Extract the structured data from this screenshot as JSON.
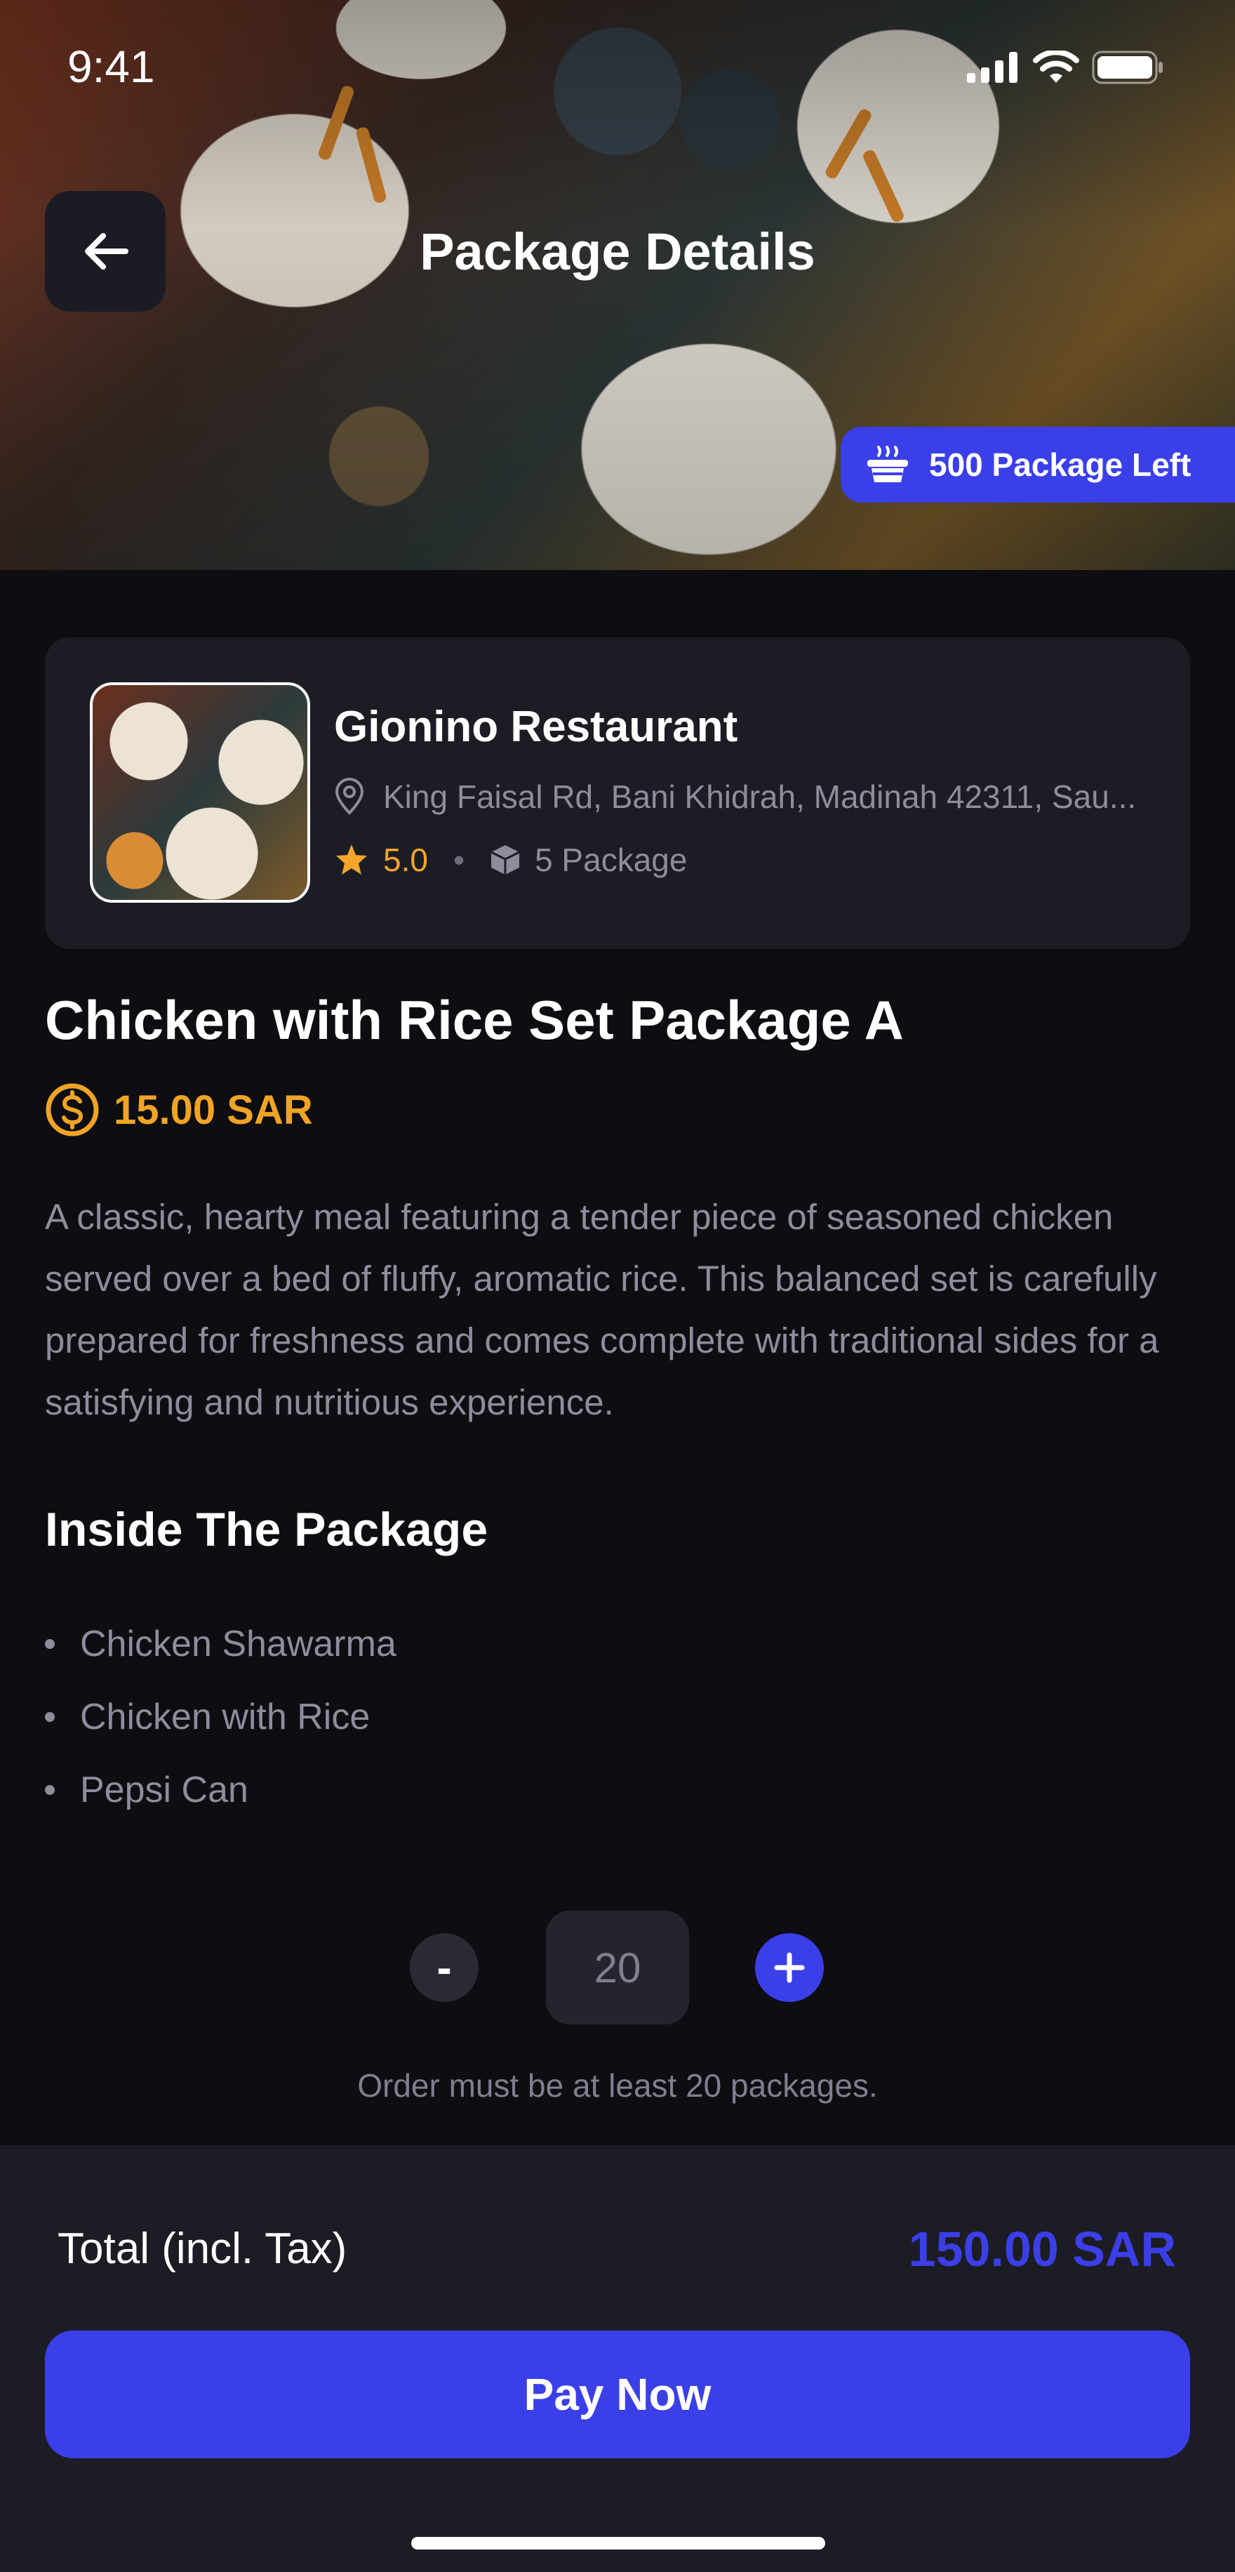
{
  "status_bar": {
    "time": "9:41"
  },
  "header": {
    "title": "Package Details",
    "packages_left": "500 Package Left"
  },
  "restaurant": {
    "name": "Gionino Restaurant",
    "address": "King Faisal Rd, Bani Khidrah, Madinah 42311, Sau...",
    "rating": "5.0",
    "package_count": "5 Package"
  },
  "package": {
    "title": "Chicken with Rice Set Package A",
    "price": "15.00 SAR",
    "description": "A classic, hearty meal featuring a tender piece of seasoned chicken served over a bed of fluffy, aromatic rice. This balanced set is carefully prepared for freshness and comes complete with traditional sides for a satisfying and nutritious experience.",
    "inside_title": "Inside The Package",
    "items": [
      "Chicken Shawarma",
      "Chicken with Rice",
      "Pepsi Can"
    ]
  },
  "quantity": {
    "minus_label": "-",
    "value": "20",
    "note": "Order must be at least 20 packages."
  },
  "footer": {
    "total_label": "Total (incl. Tax)",
    "total_value": "150.00 SAR",
    "pay_label": "Pay Now"
  },
  "colors": {
    "accent": "#3b3fe8",
    "price": "#f0a425",
    "rating": "#f4a52a",
    "background": "#0d0d12",
    "card": "#1c1c25"
  }
}
